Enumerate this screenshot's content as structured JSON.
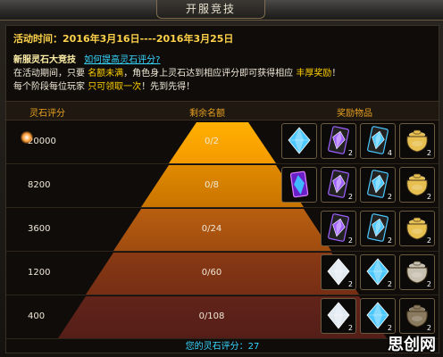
{
  "window": {
    "title": "开服竞技"
  },
  "event": {
    "time_label": "活动时间：2016年3月16日----2016年3月25日",
    "heading": "新服灵石大竞技",
    "help_link": "如何提高灵石评分?",
    "desc1_a": "在活动期间，只要",
    "desc1_b": "名额未满",
    "desc1_c": "，角色身上灵石达到相应评分即可获得相应",
    "desc1_d": "丰厚奖励",
    "desc1_e": "！",
    "desc2_a": "每个阶段每位玩家",
    "desc2_b": "只可领取一次",
    "desc2_c": "！先到先得！"
  },
  "table": {
    "col_score": "灵石评分",
    "col_quota": "剩余名额",
    "col_reward": "奖励物品",
    "rows": [
      {
        "score": "20000",
        "quota": "0/2",
        "rewards": [
          {
            "icon": "blue-crystal-icon",
            "count": ""
          },
          {
            "icon": "purple-gem-card-icon",
            "count": "2"
          },
          {
            "icon": "blue-gem-card-icon",
            "count": "4"
          },
          {
            "icon": "gold-pot-icon",
            "count": "2"
          }
        ]
      },
      {
        "score": "8200",
        "quota": "0/8",
        "rewards": [
          {
            "icon": "purple-blue-gem-icon",
            "count": ""
          },
          {
            "icon": "purple-gem-card-icon",
            "count": "2"
          },
          {
            "icon": "blue-gem-card-icon",
            "count": "2"
          },
          {
            "icon": "gold-pot-icon",
            "count": "2"
          }
        ]
      },
      {
        "score": "3600",
        "quota": "0/24",
        "rewards": [
          {
            "icon": "purple-gem-card-icon",
            "count": "2"
          },
          {
            "icon": "blue-gem-card-icon",
            "count": "2"
          },
          {
            "icon": "gold-pot-icon",
            "count": "2"
          }
        ]
      },
      {
        "score": "1200",
        "quota": "0/60",
        "rewards": [
          {
            "icon": "silver-gem-icon",
            "count": "2"
          },
          {
            "icon": "blue-round-gem-icon",
            "count": "2"
          },
          {
            "icon": "silver-pot-icon",
            "count": "2"
          }
        ]
      },
      {
        "score": "400",
        "quota": "0/108",
        "rewards": [
          {
            "icon": "silver-crystal-icon",
            "count": "2"
          },
          {
            "icon": "blue-crystal-small-icon",
            "count": "2"
          },
          {
            "icon": "dark-pot-icon",
            "count": "2"
          }
        ]
      }
    ]
  },
  "footer": {
    "my_score": "您的灵石评分：27"
  },
  "watermark": "思创网"
}
